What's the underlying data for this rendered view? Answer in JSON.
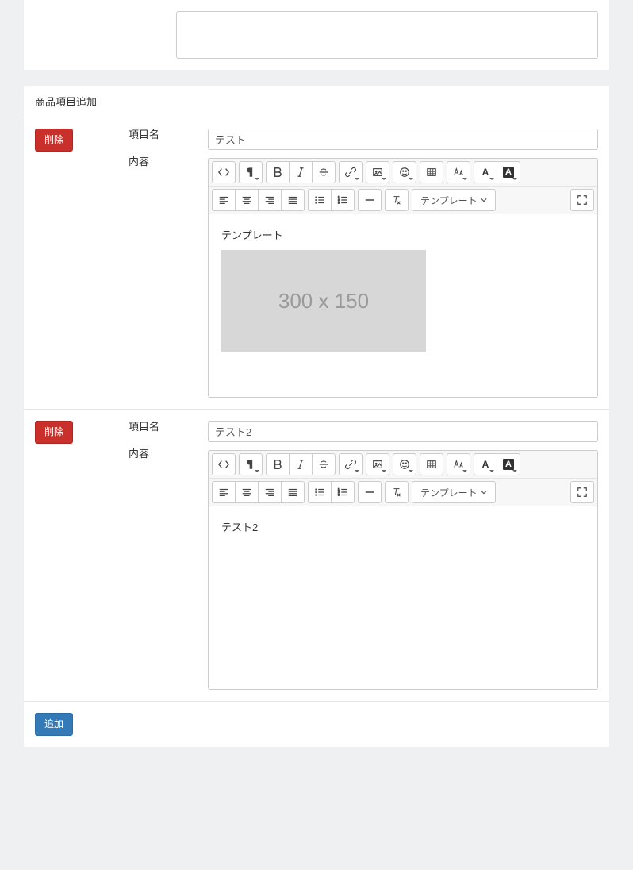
{
  "section": {
    "heading": "商品項目追加"
  },
  "labels": {
    "item_name": "項目名",
    "content": "内容"
  },
  "buttons": {
    "delete": "削除",
    "add": "追加"
  },
  "toolbar": {
    "template_dropdown": "テンプレート"
  },
  "items": [
    {
      "name_value": "テスト",
      "content_label": "テンプレート",
      "placeholder_text": "300 x 150",
      "has_placeholder": true,
      "content_text": ""
    },
    {
      "name_value": "テスト2",
      "content_label": "",
      "placeholder_text": "",
      "has_placeholder": false,
      "content_text": "テスト2"
    }
  ]
}
